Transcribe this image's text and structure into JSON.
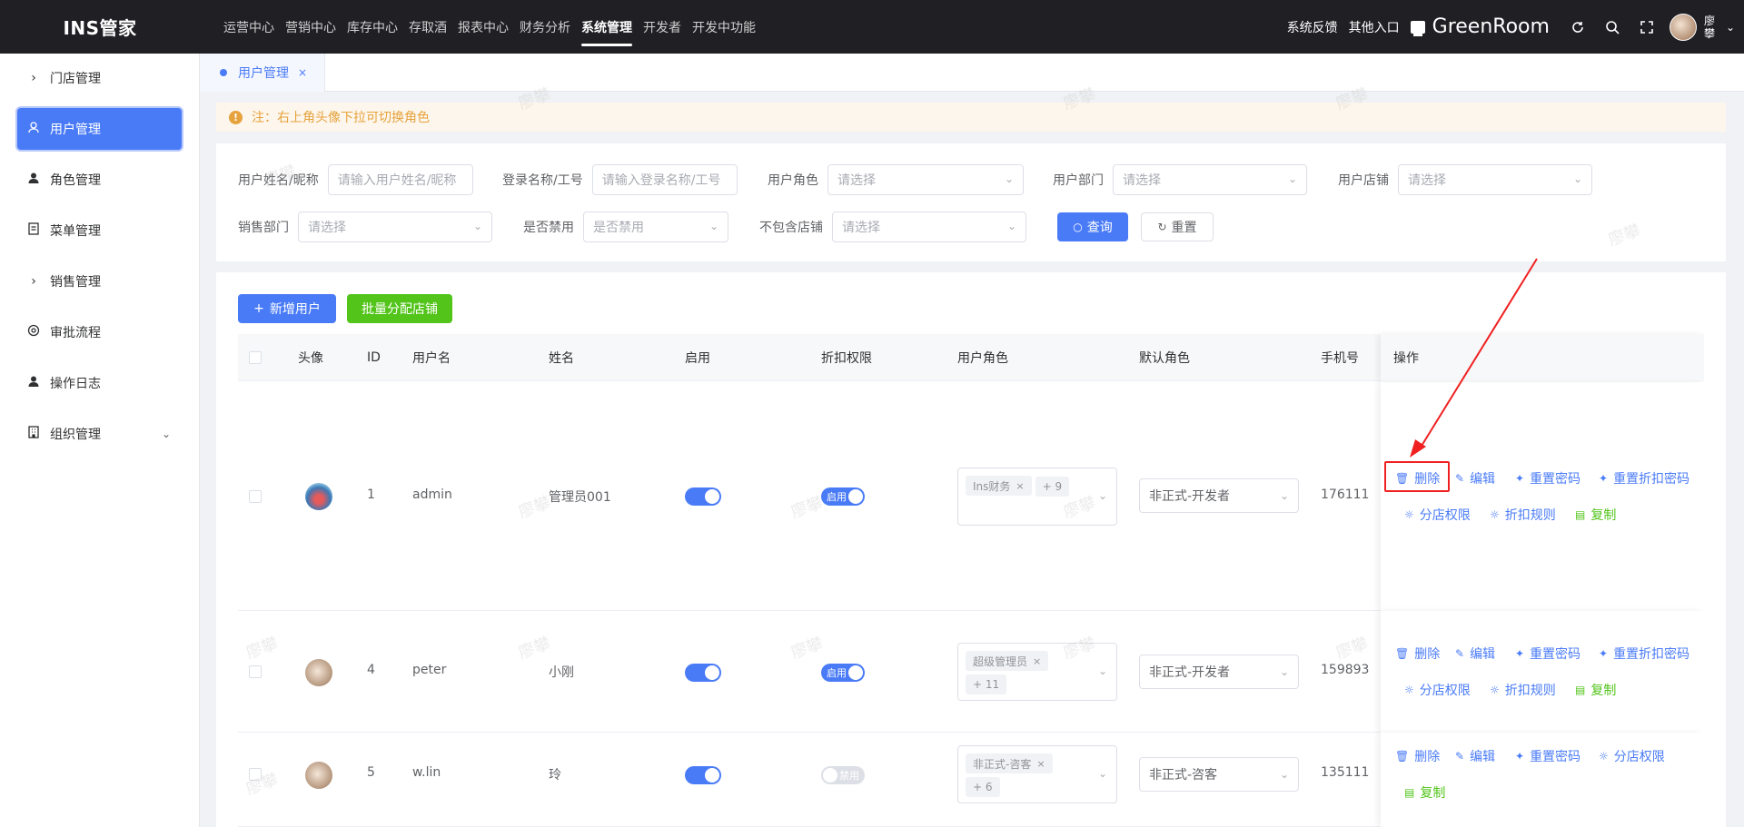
{
  "app": {
    "logo": "INS管家"
  },
  "topnav": [
    {
      "label": "运营中心"
    },
    {
      "label": "营销中心"
    },
    {
      "label": "库存中心"
    },
    {
      "label": "存取酒"
    },
    {
      "label": "报表中心"
    },
    {
      "label": "财务分析"
    },
    {
      "label": "系统管理",
      "active": true
    },
    {
      "label": "开发者"
    },
    {
      "label": "开发中功能"
    }
  ],
  "topright": {
    "feedback": "系统反馈",
    "other_entry": "其他入口",
    "store_name": "GreenRoom",
    "user_name": "廖攀"
  },
  "sidebar": [
    {
      "label": "门店管理",
      "icon": "chevron-right-icon"
    },
    {
      "label": "用户管理",
      "icon": "user-icon",
      "active": true
    },
    {
      "label": "角色管理",
      "icon": "person-icon"
    },
    {
      "label": "菜单管理",
      "icon": "document-icon"
    },
    {
      "label": "销售管理",
      "icon": "chevron-right-icon"
    },
    {
      "label": "审批流程",
      "icon": "gear-icon"
    },
    {
      "label": "操作日志",
      "icon": "person-icon"
    },
    {
      "label": "组织管理",
      "icon": "building-icon"
    }
  ],
  "tabs": [
    {
      "label": "用户管理",
      "close": "×"
    }
  ],
  "notice": {
    "text": "注：右上角头像下拉可切换角色",
    "icon": "!"
  },
  "filter": {
    "user_name_label": "用户姓名/昵称",
    "user_name_placeholder": "请输入用户姓名/昵称",
    "login_label": "登录名称/工号",
    "login_placeholder": "请输入登录名称/工号",
    "role_label": "用户角色",
    "role_placeholder": "请选择",
    "dept_label": "用户部门",
    "dept_placeholder": "请选择",
    "store_label": "用户店铺",
    "store_placeholder": "请选择",
    "sales_dept_label": "销售部门",
    "sales_dept_placeholder": "请选择",
    "disabled_label": "是否禁用",
    "disabled_placeholder": "是否禁用",
    "exclude_store_label": "不包含店铺",
    "exclude_store_placeholder": "请选择",
    "query_button": "查询",
    "reset_button": "重置"
  },
  "toolbar": {
    "add_user": "新增用户",
    "batch_assign": "批量分配店铺"
  },
  "table": {
    "headers": {
      "avatar": "头像",
      "id": "ID",
      "username": "用户名",
      "name": "姓名",
      "enabled": "启用",
      "discount": "折扣权限",
      "roles": "用户角色",
      "default_role": "默认角色",
      "phone": "手机号",
      "ops": "操作"
    },
    "rows": [
      {
        "id": "1",
        "username": "admin",
        "name": "管理员001",
        "discount_label": "启用",
        "discount_on": true,
        "role_tag": "Ins财务",
        "role_more": "+ 9",
        "default_role": "非正式-开发者",
        "phone": "176111",
        "ops": [
          "删除",
          "编辑",
          "重置密码",
          "重置折扣密码",
          "分店权限",
          "折扣规则",
          "复制"
        ]
      },
      {
        "id": "4",
        "username": "peter",
        "name": "小刚",
        "discount_label": "启用",
        "discount_on": true,
        "role_tag": "超级管理员",
        "role_more": "+ 11",
        "default_role": "非正式-开发者",
        "phone": "159893",
        "ops": [
          "删除",
          "编辑",
          "重置密码",
          "重置折扣密码",
          "分店权限",
          "折扣规则",
          "复制"
        ]
      },
      {
        "id": "5",
        "username": "w.lin",
        "name": "玲",
        "discount_label": "禁用",
        "discount_on": false,
        "role_tag": "非正式-咨客",
        "role_more": "+ 6",
        "default_role": "非正式-咨客",
        "phone": "135111",
        "ops": [
          "删除",
          "编辑",
          "重置密码",
          "分店权限",
          "复制"
        ]
      }
    ]
  },
  "watermark_text": "廖攀",
  "colors": {
    "primary": "#4a7bf7",
    "success": "#52c41a",
    "warning": "#e6a23c",
    "highlight": "#f02020",
    "topbar": "#1f1f24"
  }
}
